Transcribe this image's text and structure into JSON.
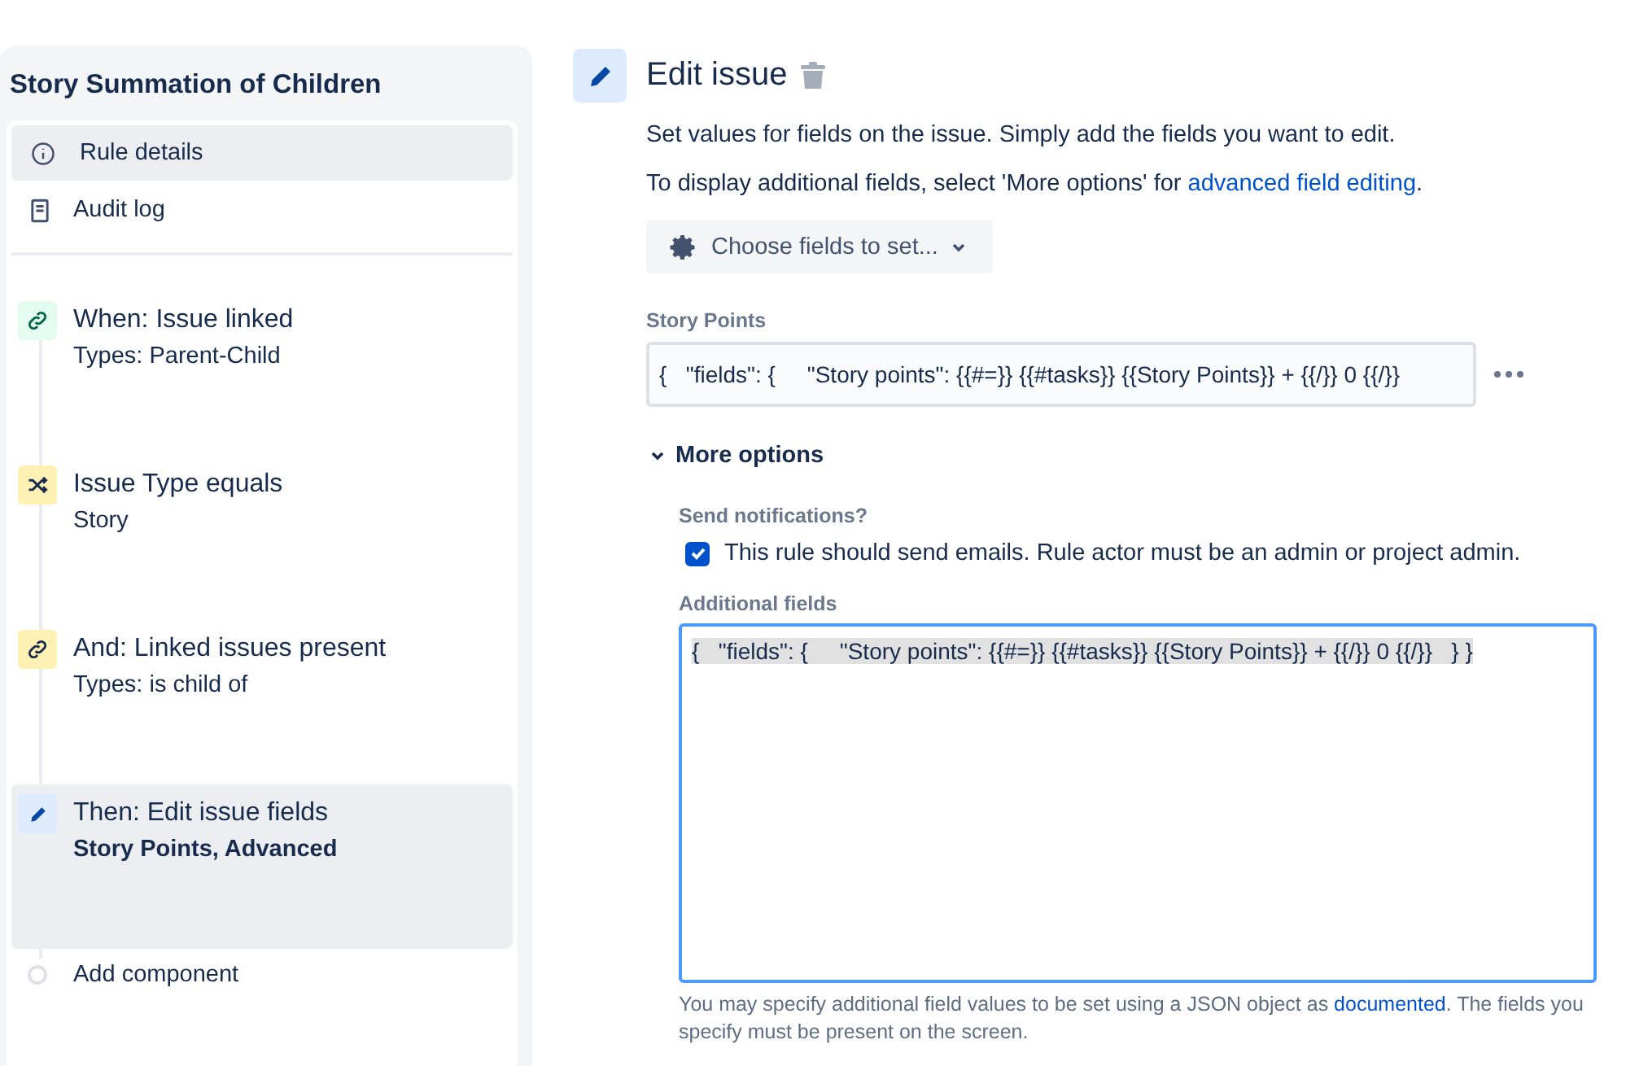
{
  "sidebar": {
    "title": "Story Summation of Children",
    "nav": [
      {
        "label": "Rule details",
        "selected": true
      },
      {
        "label": "Audit log",
        "selected": false
      }
    ],
    "steps": [
      {
        "kind": "trigger",
        "title": "When: Issue linked",
        "subtitle": "Types: Parent-Child",
        "bold_subtitle": false,
        "selected": false
      },
      {
        "kind": "condition",
        "title": "Issue Type equals",
        "subtitle": "Story",
        "bold_subtitle": false,
        "selected": false
      },
      {
        "kind": "link-condition",
        "title": "And: Linked issues present",
        "subtitle": "Types: is child of",
        "bold_subtitle": false,
        "selected": false
      },
      {
        "kind": "action",
        "title": "Then: Edit issue fields",
        "subtitle": "Story Points, Advanced",
        "bold_subtitle": true,
        "selected": true
      },
      {
        "kind": "add",
        "title": "Add component",
        "selected": false
      }
    ]
  },
  "editor": {
    "title": "Edit issue",
    "paragraphs": [
      {
        "text": "Set values for fields on the issue. Simply add the fields you want to edit."
      },
      {
        "text": "To display additional fields, select 'More options' for ",
        "link": "advanced field editing",
        "after": "."
      }
    ],
    "choose_button": "Choose fields to set...",
    "story_points": {
      "label": "Story Points",
      "value": "{   \"fields\": {     \"Story points\": {{#=}} {{#tasks}} {{Story Points}} + {{/}} 0 {{/}}"
    },
    "more_options": {
      "label": "More options",
      "expanded": true,
      "notify_label": "Send notifications?",
      "notify_text": "This rule should send emails. Rule actor must be an admin or project admin.",
      "checked": true,
      "additional_label": "Additional fields",
      "additional_value": "{   \"fields\": {     \"Story points\": {{#=}} {{#tasks}} {{Story Points}} + {{/}} 0 {{/}}   } }",
      "focused": true,
      "help_text": "You may specify additional field values to be set using a JSON object as ",
      "help_link": "documented",
      "help_after": ". The fields you specify must be present on the screen."
    }
  }
}
